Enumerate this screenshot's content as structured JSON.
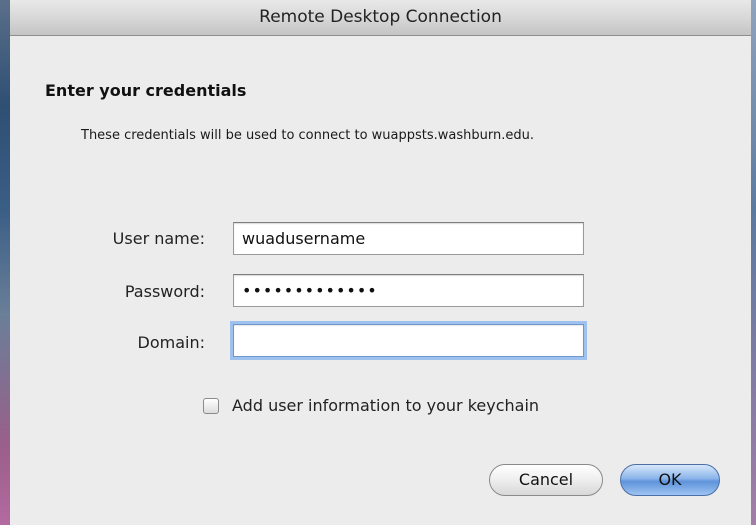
{
  "window": {
    "title": "Remote Desktop Connection"
  },
  "prompt": {
    "heading": "Enter your credentials",
    "description": "These credentials will be used to connect to wuappsts.washburn.edu."
  },
  "form": {
    "username": {
      "label": "User name:",
      "value": "wuadusername"
    },
    "password": {
      "label": "Password:",
      "value": "•••••••••••••"
    },
    "domain": {
      "label": "Domain:",
      "value": ""
    }
  },
  "keychain": {
    "label": "Add user information to your keychain",
    "checked": false
  },
  "buttons": {
    "cancel": "Cancel",
    "ok": "OK"
  }
}
